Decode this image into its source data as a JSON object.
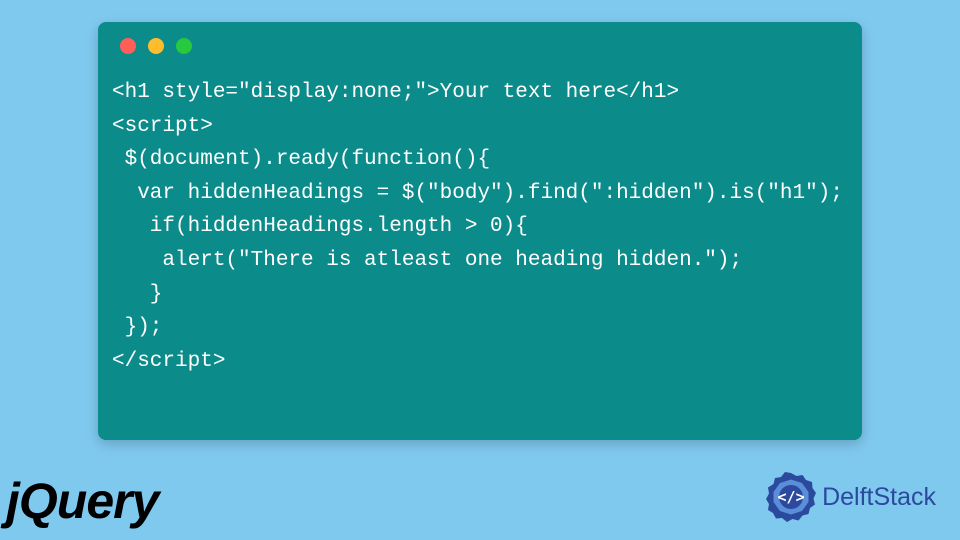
{
  "code": {
    "lines": [
      "<h1 style=\"display:none;\">Your text here</h1>",
      "<script>",
      " $(document).ready(function(){",
      "  var hiddenHeadings = $(\"body\").find(\":hidden\").is(\"h1\");",
      "   if(hiddenHeadings.length > 0){",
      "    alert(\"There is atleast one heading hidden.\");",
      "   }",
      " });",
      "</script>"
    ]
  },
  "logos": {
    "jquery": "jQuery",
    "delftstack": "DelftStack",
    "delftstack_icon": "</>"
  }
}
